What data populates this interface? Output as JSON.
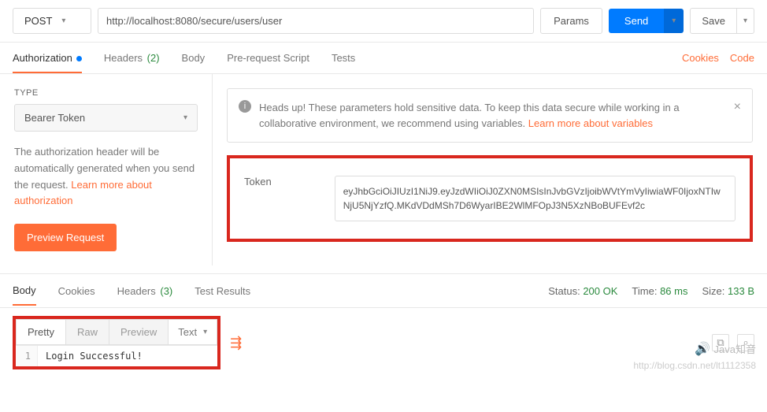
{
  "request": {
    "method": "POST",
    "url": "http://localhost:8080/secure/users/user",
    "params_label": "Params",
    "send_label": "Send",
    "save_label": "Save"
  },
  "req_tabs": {
    "authorization": "Authorization",
    "headers": "Headers",
    "headers_count": "(2)",
    "body": "Body",
    "prerequest": "Pre-request Script",
    "tests": "Tests",
    "cookies_link": "Cookies",
    "code_link": "Code"
  },
  "auth": {
    "type_label": "TYPE",
    "type_value": "Bearer Token",
    "description_pre": "The authorization header will be automatically generated when you send the request. ",
    "description_link": "Learn more about authorization",
    "preview_btn": "Preview Request"
  },
  "banner": {
    "text_pre": "Heads up! These parameters hold sensitive data. To keep this data secure while working in a collaborative environment, we recommend using variables. ",
    "link": "Learn more about variables"
  },
  "token": {
    "label": "Token",
    "value": "eyJhbGciOiJIUzI1NiJ9.eyJzdWIiOiJ0ZXN0MSIsInJvbGVzIjoibWVtYmVyIiwiaWF0IjoxNTIwNjU5NjYzfQ.MKdVDdMSh7D6WyarIBE2WlMFOpJ3N5XzNBoBUFEvf2c"
  },
  "resp_tabs": {
    "body": "Body",
    "cookies": "Cookies",
    "headers": "Headers",
    "headers_count": "(3)",
    "tests": "Test Results"
  },
  "resp_meta": {
    "status_label": "Status:",
    "status_value": "200 OK",
    "time_label": "Time:",
    "time_value": "86 ms",
    "size_label": "Size:",
    "size_value": "133 B"
  },
  "view": {
    "pretty": "Pretty",
    "raw": "Raw",
    "preview": "Preview",
    "format": "Text"
  },
  "response_body": {
    "line_no": "1",
    "content": "Login Successful!"
  },
  "watermark1": "Java知音",
  "watermark2": "http://blog.csdn.net/lt1112358"
}
